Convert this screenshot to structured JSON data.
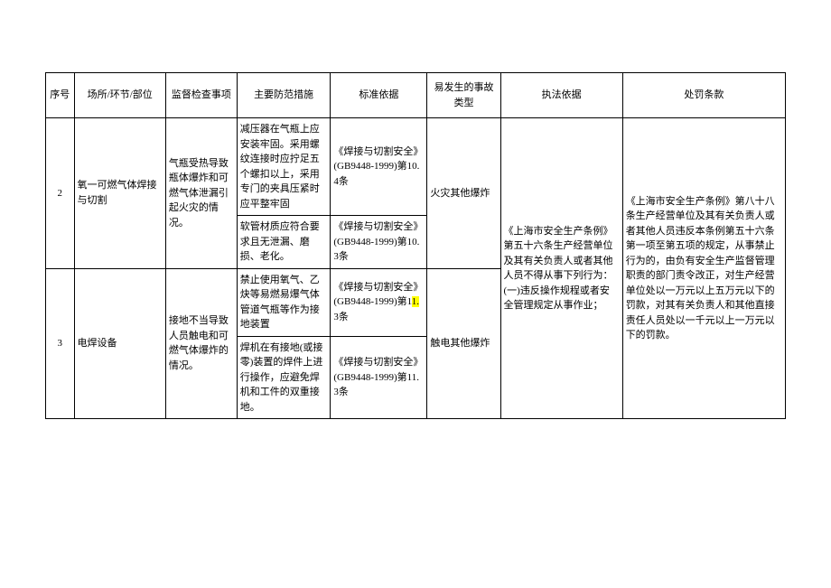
{
  "headers": {
    "seq": "序号",
    "place": "场所/环节/部位",
    "inspect": "监督检查事项",
    "measure": "主要防范措施",
    "standard": "标准依据",
    "accident": "易发生的事故类型",
    "law": "执法依据",
    "penalty": "处罚条款"
  },
  "rows": [
    {
      "seq": "2",
      "place": "氧一可燃气体焊接与切割",
      "inspect": "气瓶受热导致瓶体爆炸和可燃气体泄漏引起火灾的情况。",
      "sub": [
        {
          "measure": "减压器在气瓶上应安装牢固。采用螺纹连接时应拧足五个螺扣以上，采用专门的夹具压紧时应平整牢固",
          "standard": "《焊接与切割安全》(GB9448-1999)第10.4条"
        },
        {
          "measure": "软管材质应符合要求且无泄漏、磨损、老化。",
          "standard": "《焊接与切割安全》(GB9448-1999)第10.3条"
        }
      ],
      "accident": "火灾其他爆炸"
    },
    {
      "seq": "3",
      "place": "电焊设备",
      "inspect": "接地不当导致人员触电和可燃气体爆炸的情况。",
      "sub": [
        {
          "measure": "禁止使用氧气、乙炔等易燃易爆气体管道气瓶等作为接地装置",
          "standard_pre": "《焊接与切割安全》(GB9448-1999)第1",
          "standard_hl": "1.",
          "standard_post": "3条"
        },
        {
          "measure": "焊机在有接地(或接零)装置的焊件上进行操作，应避免焊机和工件的双重接地。",
          "standard": "《焊接与切割安全》(GB9448-1999)第11.3条"
        }
      ],
      "accident": "触电其他爆炸"
    }
  ],
  "shared": {
    "law": "《上海市安全生产条例》第五十六条生产经营单位及其有关负责人或者其他人员不得从事下列行为：(一)违反操作规程或者安全管理规定从事作业；",
    "penalty": "《上海市安全生产条例》第八十八条生产经营单位及其有关负责人或者其他人员违反本条例第五十六条第一项至第五项的规定，从事禁止行为的，由负有安全生产监督管理职责的部门责令改正，对生产经营单位处以一万元以上五万元以下的罚款，对其有关负责人和其他直接责任人员处以一千元以上一万元以下的罚款。"
  }
}
